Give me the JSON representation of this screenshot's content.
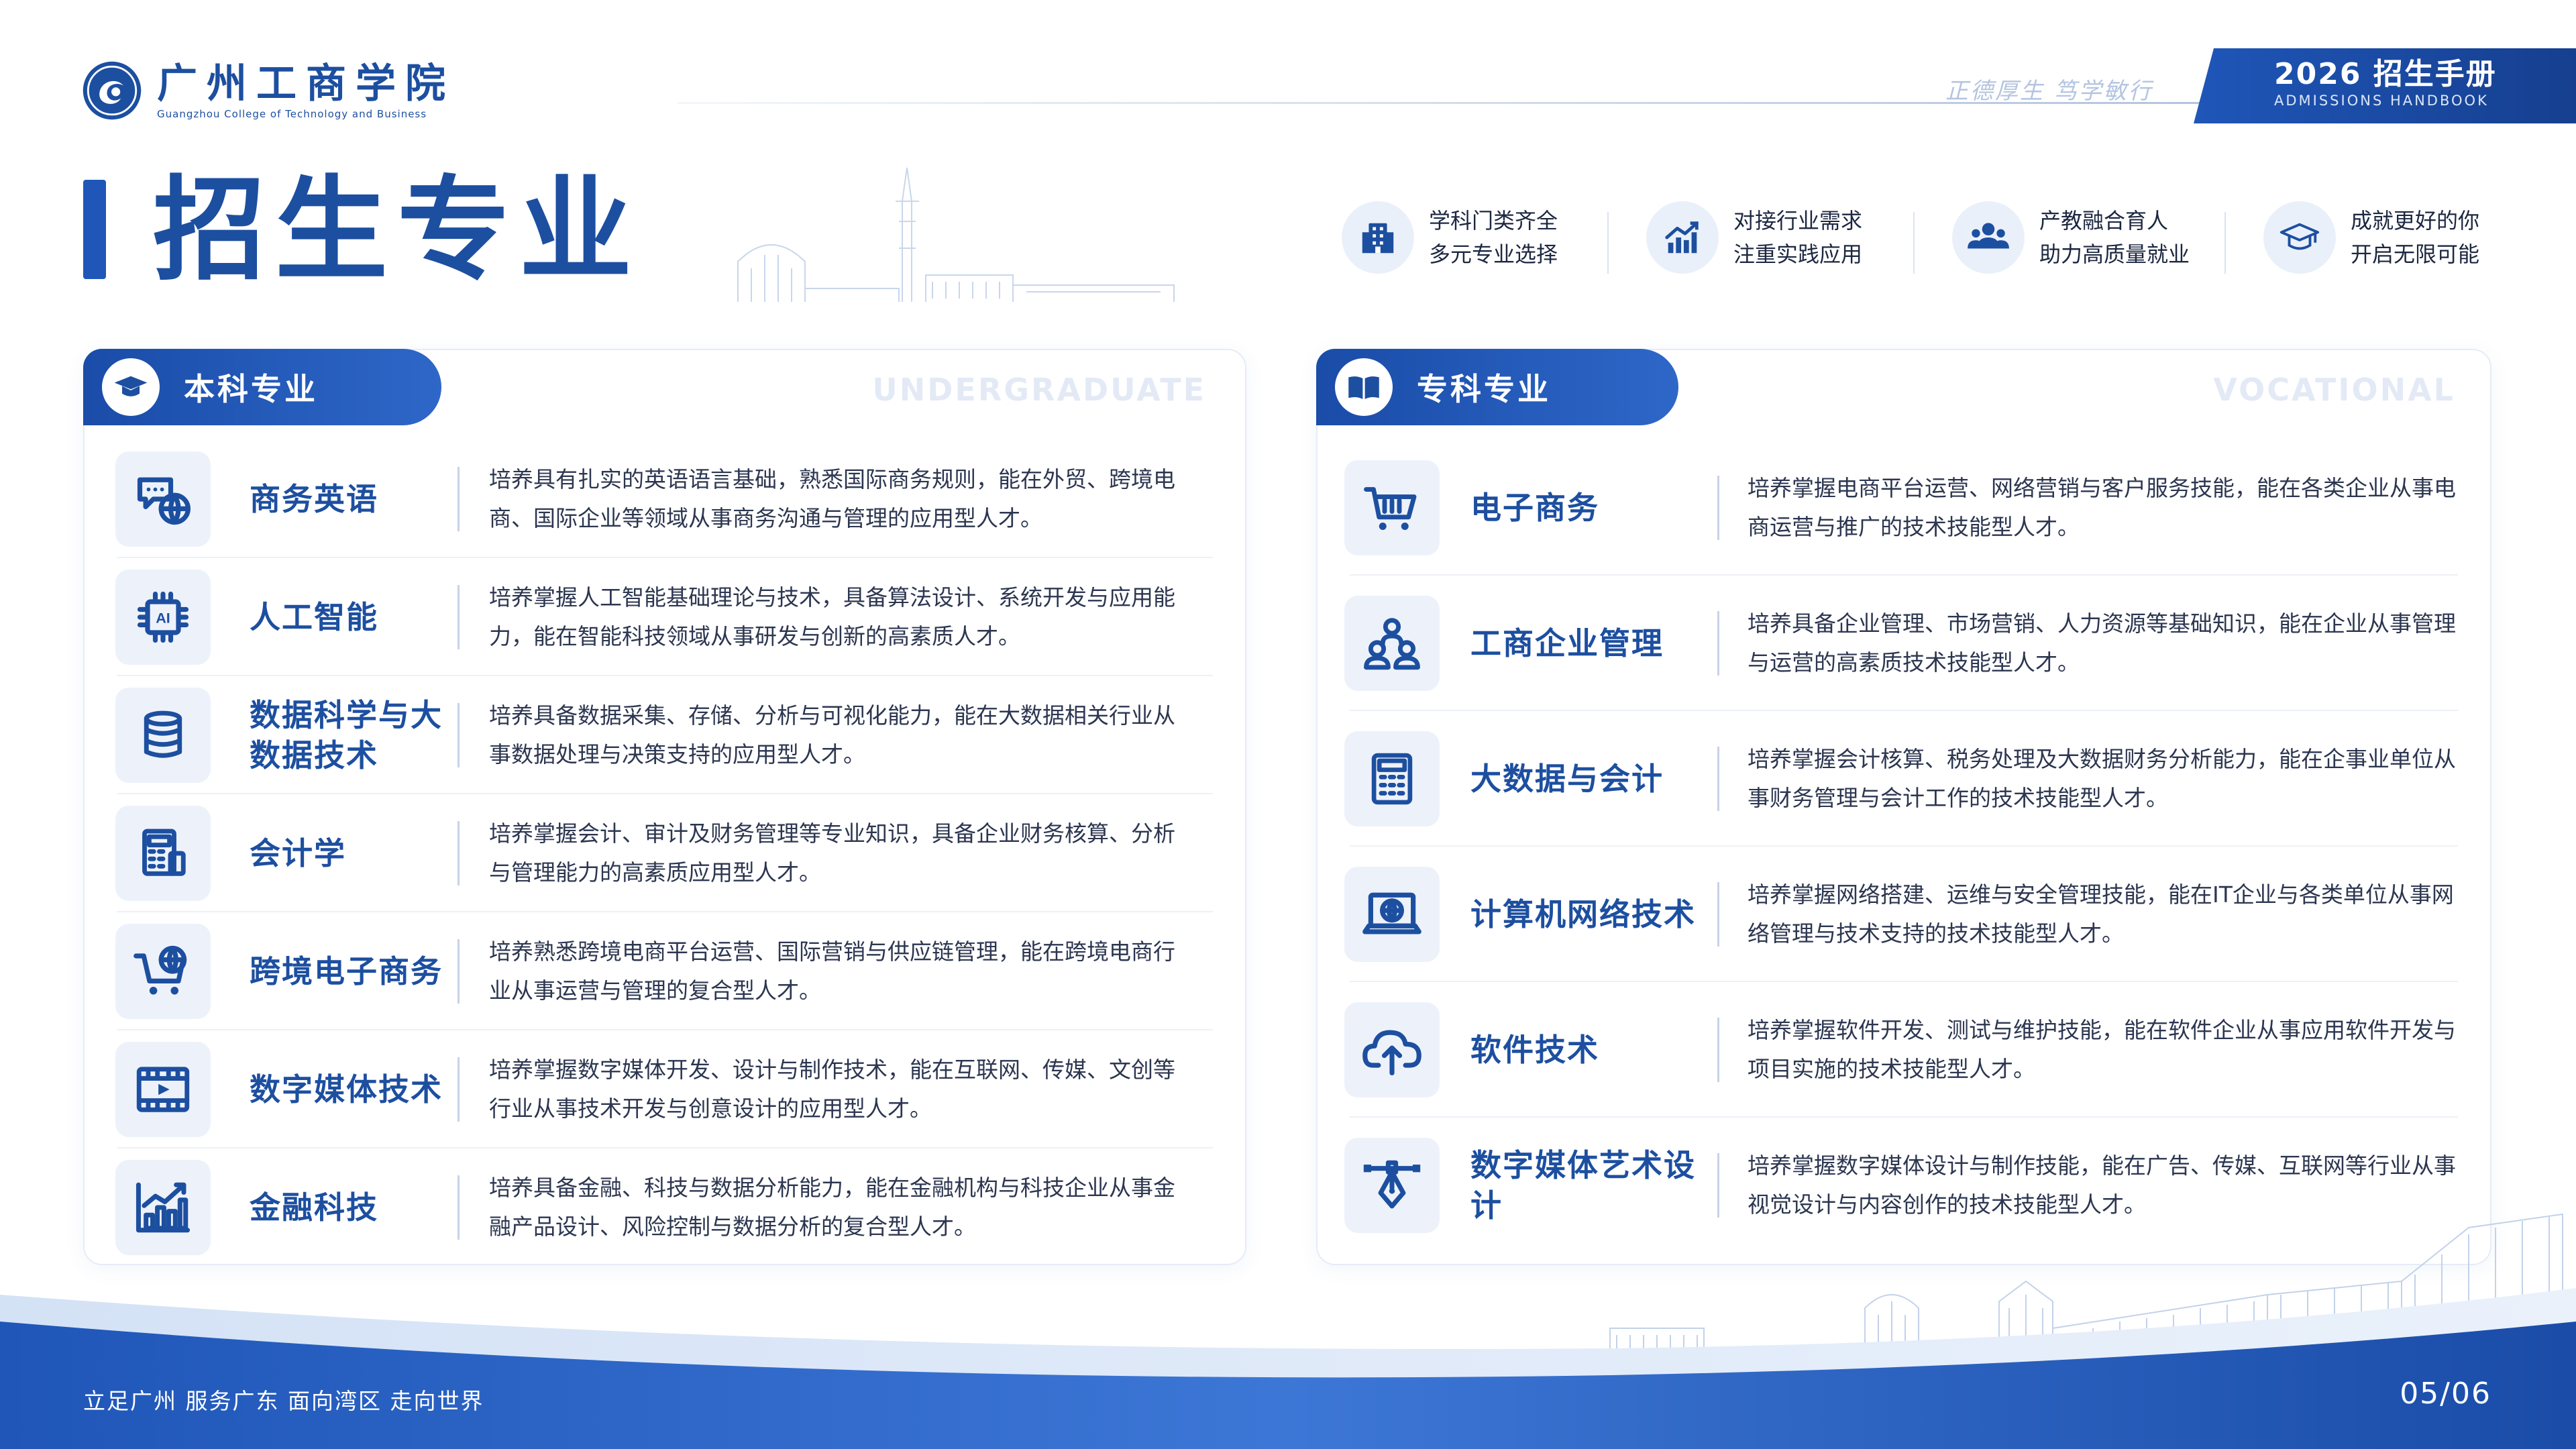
{
  "header": {
    "logo_cn": "广州工商学院",
    "logo_en": "Guangzhou College of Technology and Business",
    "motto": "正德厚生  笃学敏行",
    "badge_title": "2026 招生手册",
    "badge_sub": "ADMISSIONS HANDBOOK"
  },
  "page_title": "招生专业",
  "features": [
    {
      "icon": "building-icon",
      "line1": "学科门类齐全",
      "line2": "多元专业选择"
    },
    {
      "icon": "growth-chart-icon",
      "line1": "对接行业需求",
      "line2": "注重实践应用"
    },
    {
      "icon": "people-icon",
      "line1": "产教融合育人",
      "line2": "助力高质量就业"
    },
    {
      "icon": "graduation-cap-icon",
      "line1": "成就更好的你",
      "line2": "开启无限可能"
    }
  ],
  "undergraduate": {
    "label": "本科专业",
    "label_en": "UNDERGRADUATE",
    "majors": [
      {
        "icon": "chat-globe-icon",
        "name": "商务英语",
        "desc": "培养具有扎实的英语语言基础，熟悉国际商务规则，能在外贸、跨境电商、国际企业等领域从事商务沟通与管理的应用型人才。"
      },
      {
        "icon": "ai-chip-icon",
        "name": "人工智能",
        "desc": "培养掌握人工智能基础理论与技术，具备算法设计、系统开发与应用能力，能在智能科技领域从事研发与创新的高素质人才。"
      },
      {
        "icon": "database-icon",
        "name": "数据科学与大数据技术",
        "desc": "培养具备数据采集、存储、分析与可视化能力，能在大数据相关行业从事数据处理与决策支持的应用型人才。"
      },
      {
        "icon": "calculator-icon",
        "name": "会计学",
        "desc": "培养掌握会计、审计及财务管理等专业知识，具备企业财务核算、分析与管理能力的高素质应用型人才。"
      },
      {
        "icon": "cart-globe-icon",
        "name": "跨境电子商务",
        "desc": "培养熟悉跨境电商平台运营、国际营销与供应链管理，能在跨境电商行业从事运营与管理的复合型人才。"
      },
      {
        "icon": "video-play-icon",
        "name": "数字媒体技术",
        "desc": "培养掌握数字媒体开发、设计与制作技术，能在互联网、传媒、文创等行业从事技术开发与创意设计的应用型人才。"
      },
      {
        "icon": "finance-chart-icon",
        "name": "金融科技",
        "desc": "培养具备金融、科技与数据分析能力，能在金融机构与科技企业从事金融产品设计、风险控制与数据分析的复合型人才。"
      }
    ]
  },
  "vocational": {
    "label": "专科专业",
    "label_en": "VOCATIONAL",
    "majors": [
      {
        "icon": "shopping-cart-icon",
        "name": "电子商务",
        "desc": "培养掌握电商平台运营、网络营销与客户服务技能，能在各类企业从事电商运营与推广的技术技能型人才。"
      },
      {
        "icon": "team-icon",
        "name": "工商企业管理",
        "desc": "培养具备企业管理、市场营销、人力资源等基础知识，能在企业从事管理与运营的高素质技术技能型人才。"
      },
      {
        "icon": "accounting-calculator-icon",
        "name": "大数据与会计",
        "desc": "培养掌握会计核算、税务处理及大数据财务分析能力，能在企事业单位从事财务管理与会计工作的技术技能型人才。"
      },
      {
        "icon": "laptop-globe-icon",
        "name": "计算机网络技术",
        "desc": "培养掌握网络搭建、运维与安全管理技能，能在IT企业与各类单位从事网络管理与技术支持的技术技能型人才。"
      },
      {
        "icon": "cloud-upload-icon",
        "name": "软件技术",
        "desc": "培养掌握软件开发、测试与维护技能，能在软件企业从事应用软件开发与项目实施的技术技能型人才。"
      },
      {
        "icon": "pen-tool-icon",
        "name": "数字媒体艺术设计",
        "desc": "培养掌握数字媒体设计与制作技能，能在广告、传媒、互联网等行业从事视觉设计与内容创作的技术技能型人才。"
      }
    ]
  },
  "footer": {
    "slogan": "立足广州  服务广东  面向湾区  走向世界",
    "page": "05/06"
  },
  "colors": {
    "primary": "#1d4fa0",
    "accent": "#1f56b8",
    "light_bg": "#edf2fa"
  }
}
